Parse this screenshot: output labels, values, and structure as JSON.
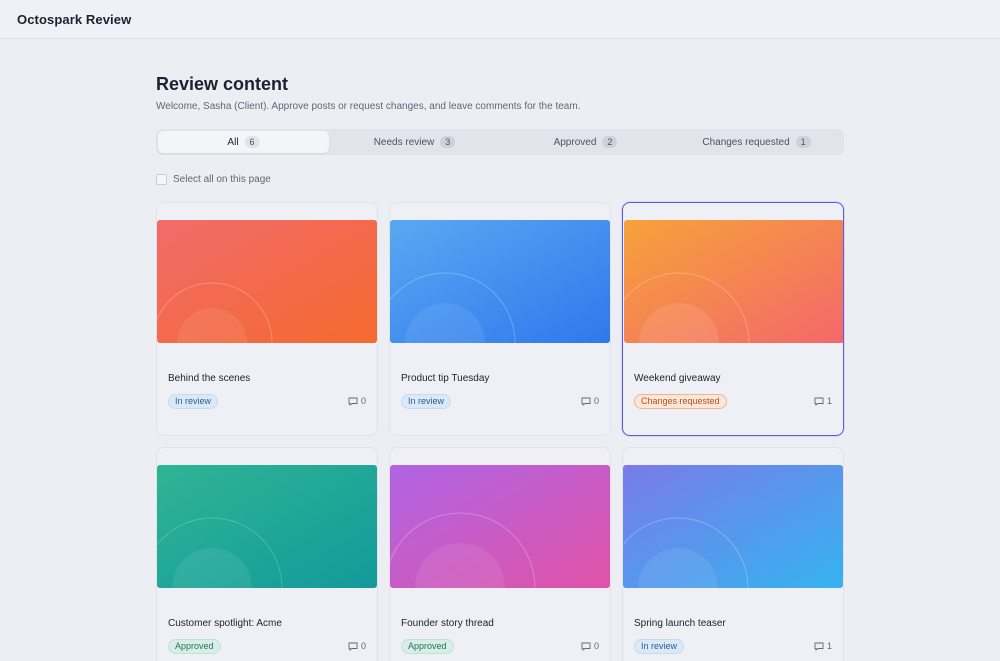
{
  "app": {
    "title": "Octospark Review"
  },
  "page": {
    "title": "Review content",
    "subtitle": "Welcome, Sasha (Client). Approve posts or request changes, and leave comments for the team."
  },
  "tabs": [
    {
      "label": "All",
      "count": "6",
      "active": true
    },
    {
      "label": "Needs review",
      "count": "3",
      "active": false
    },
    {
      "label": "Approved",
      "count": "2",
      "active": false
    },
    {
      "label": "Changes requested",
      "count": "1",
      "active": false
    }
  ],
  "select_all": {
    "label": "Select all on this page"
  },
  "icons": {
    "comment": "comment-icon",
    "checkbox": "checkbox-icon"
  },
  "status_colors": {
    "in_review": "#2b5d93",
    "approved": "#2a7256",
    "changes_requested": "#b2531d",
    "selection": "#5b5be6"
  },
  "posts": [
    {
      "title": "Behind the scenes",
      "status": "In review",
      "status_key": "review",
      "comments": "0",
      "selected": false,
      "gradient": [
        "#f26b6b",
        "#f46a2e"
      ]
    },
    {
      "title": "Product tip Tuesday",
      "status": "In review",
      "status_key": "review",
      "comments": "0",
      "selected": false,
      "gradient": [
        "#58a9f2",
        "#2f78ec"
      ]
    },
    {
      "title": "Weekend giveaway",
      "status": "Changes requested",
      "status_key": "changes",
      "comments": "1",
      "selected": true,
      "gradient": [
        "#f6a23a",
        "#f4686a"
      ]
    },
    {
      "title": "Customer spotlight: Acme",
      "status": "Approved",
      "status_key": "approved",
      "comments": "0",
      "selected": false,
      "gradient": [
        "#2fb494",
        "#129a9a"
      ]
    },
    {
      "title": "Founder story thread",
      "status": "Approved",
      "status_key": "approved",
      "comments": "0",
      "selected": false,
      "gradient": [
        "#b064e5",
        "#e053a7"
      ]
    },
    {
      "title": "Spring launch teaser",
      "status": "In review",
      "status_key": "review",
      "comments": "1",
      "selected": false,
      "gradient": [
        "#7a7be9",
        "#35b3ef"
      ]
    }
  ]
}
